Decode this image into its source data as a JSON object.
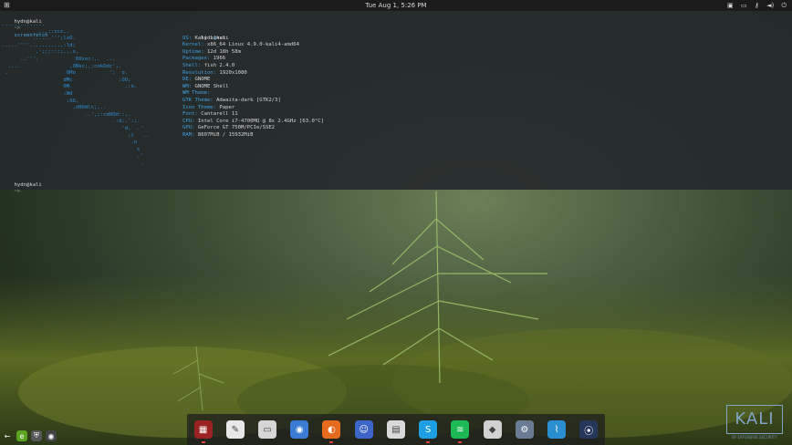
{
  "topbar": {
    "apps_icon": "grid-icon",
    "clock": "Tue Aug  1,  5:26 PM",
    "tray_icons": [
      "window-icon",
      "screen-icon",
      "key-icon",
      "volume-icon",
      "power-icon"
    ]
  },
  "terminal": {
    "prompt_user": "hydn@kali",
    "prompt_arrow": "~>",
    "command": "screenfetch",
    "second_prompt_user": "hydn@kali",
    "second_prompt_arrow": "~>",
    "logo_art": "..............\n            ..,;:ccc,.\n          ......''';lxO.\n.....''''..........,:ld;\n           .';;;:::;,,.x,\n      ..'''.            0Xxoc:,.  ...\n  ....                ,ONkc;,;cokOdc',.\n .                   OMo           ':  o.\n                    dMc               :OO;\n                    0M.                 .:o.\n                    ;Wd\n                     ;XO,\n                       ,d0Odlc;,..\n                           ..',;:cdOOd::,.\n                                    .:d;.':;.\n                                       'd,  .'\n                                         ;l   ..\n                                          .o\n                                            c\n                                            .'\n                                             .",
    "info_header_user": "hydn",
    "info_header_at": "@",
    "info_header_host": "kali",
    "info": [
      {
        "key": "OS:",
        "value": "Kali Linux"
      },
      {
        "key": "Kernel:",
        "value": "x86_64 Linux 4.9.0-kali4-amd64"
      },
      {
        "key": "Uptime:",
        "value": "12d 18h 58m"
      },
      {
        "key": "Packages:",
        "value": "1966"
      },
      {
        "key": "Shell:",
        "value": "fish 2.4.0"
      },
      {
        "key": "Resolution:",
        "value": "1920x1080"
      },
      {
        "key": "DE:",
        "value": "GNOME"
      },
      {
        "key": "WM:",
        "value": "GNOME Shell"
      },
      {
        "key": "WM Theme:",
        "value": ""
      },
      {
        "key": "GTK Theme:",
        "value": "Adwaita-dark [GTK2/3]"
      },
      {
        "key": "Icon Theme:",
        "value": "Paper"
      },
      {
        "key": "Font:",
        "value": "Cantarell 11"
      },
      {
        "key": "CPU:",
        "value": "Intel Core i7-4700MQ @ 8x 2.4GHz [63.0°C]"
      },
      {
        "key": "GPU:",
        "value": "GeForce GT 750M/PCIe/SSE2"
      },
      {
        "key": "RAM:",
        "value": "8607MiB / 15932MiB"
      }
    ]
  },
  "dock": [
    {
      "name": "dock-app-red",
      "icon": "app-icon",
      "color": "#9b2222",
      "glyph": "▦",
      "running": true
    },
    {
      "name": "dock-app-document",
      "icon": "document-icon",
      "color": "#e8e8e8",
      "glyph": "✎",
      "running": false
    },
    {
      "name": "dock-app-files",
      "icon": "folder-icon",
      "color": "#d6d6d6",
      "glyph": "▭",
      "running": false
    },
    {
      "name": "dock-app-chrome",
      "icon": "chrome-icon",
      "color": "#3b7bd4",
      "glyph": "◉",
      "running": false
    },
    {
      "name": "dock-app-firefox",
      "icon": "firefox-icon",
      "color": "#e66b1f",
      "glyph": "◐",
      "running": true
    },
    {
      "name": "dock-app-contacts",
      "icon": "contacts-icon",
      "color": "#3e66c9",
      "glyph": "☺",
      "running": false
    },
    {
      "name": "dock-app-calendar",
      "icon": "calendar-icon",
      "color": "#d9d9d9",
      "glyph": "▤",
      "running": false
    },
    {
      "name": "dock-app-skype",
      "icon": "skype-icon",
      "color": "#1f9fe3",
      "glyph": "S",
      "running": true
    },
    {
      "name": "dock-app-spotify",
      "icon": "spotify-icon",
      "color": "#1db954",
      "glyph": "≋",
      "running": true
    },
    {
      "name": "dock-app-store",
      "icon": "store-icon",
      "color": "#d2d2d2",
      "glyph": "◆",
      "running": false
    },
    {
      "name": "dock-app-settings",
      "icon": "gear-icon",
      "color": "#6a7c93",
      "glyph": "⚙",
      "running": false
    },
    {
      "name": "dock-app-monitor",
      "icon": "monitor-icon",
      "color": "#2a8fd0",
      "glyph": "⌇",
      "running": false
    },
    {
      "name": "dock-app-steam",
      "icon": "steam-icon",
      "color": "#25375a",
      "glyph": "⦿",
      "running": false
    }
  ],
  "tray_left": [
    {
      "name": "arrow-left-icon",
      "color": "transparent",
      "glyph": "←"
    },
    {
      "name": "evernote-icon",
      "color": "#5ba523",
      "glyph": "e"
    },
    {
      "name": "shield-icon",
      "color": "#555555",
      "glyph": "⛨"
    },
    {
      "name": "steam-tray-icon",
      "color": "#444444",
      "glyph": "◉"
    }
  ],
  "watermark": {
    "text": "KALI",
    "subtext": "BY OFFENSIVE SECURITY"
  },
  "colors": {
    "terminal_bg": "#262a2c",
    "accent": "#3f9fe0",
    "topbar": "#1b1b1b"
  }
}
